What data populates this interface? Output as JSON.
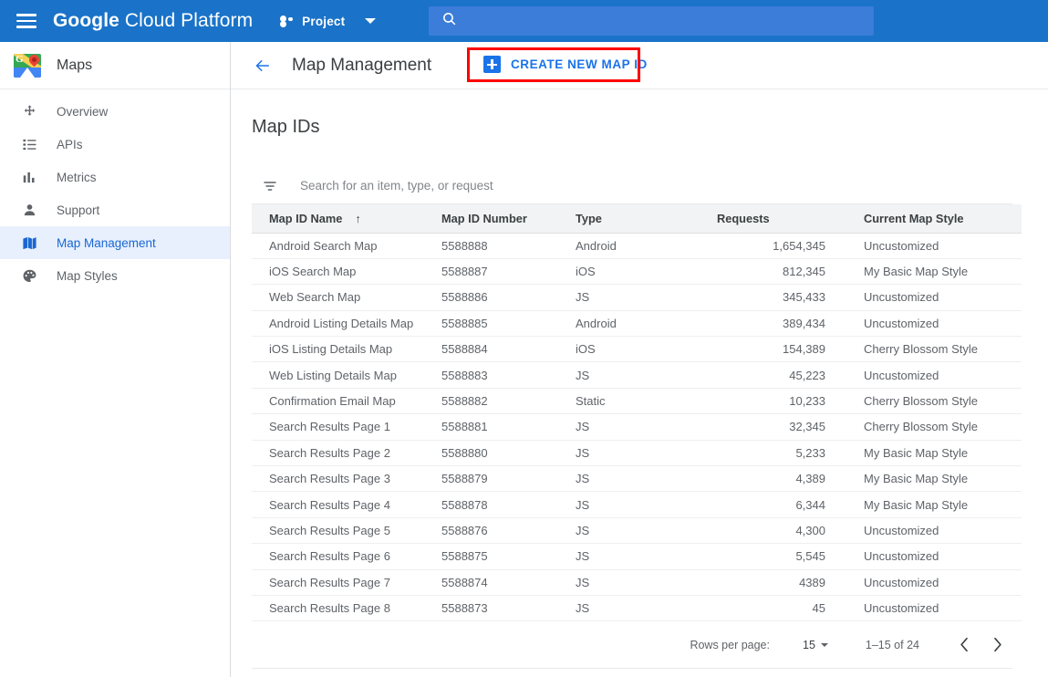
{
  "topbar": {
    "menu_icon": "hamburger-icon",
    "brand_bold": "Google",
    "brand_light": "Cloud Platform",
    "project_label": "Project",
    "project_icon": "project-dots-icon",
    "caret_icon": "chevron-down-icon",
    "search_icon": "search-icon",
    "search_value": "",
    "search_placeholder": "",
    "background_color": "#1a73c8",
    "search_background_color": "#3b7dd8"
  },
  "sidebar": {
    "product_title": "Maps",
    "product_icon": "google-maps-logo-icon",
    "items": [
      {
        "label": "Overview",
        "icon": "move-arrows-icon",
        "active": false
      },
      {
        "label": "APIs",
        "icon": "list-icon",
        "active": false
      },
      {
        "label": "Metrics",
        "icon": "bar-chart-icon",
        "active": false
      },
      {
        "label": "Support",
        "icon": "person-icon",
        "active": false
      },
      {
        "label": "Map Management",
        "icon": "map-icon",
        "active": true
      },
      {
        "label": "Map Styles",
        "icon": "palette-icon",
        "active": false
      }
    ],
    "active_color": "#1967d2",
    "active_background": "#e8f0fe"
  },
  "page_header": {
    "back_icon": "back-arrow-icon",
    "title": "Map Management",
    "create_button_label": "CREATE NEW MAP ID",
    "create_button_icon": "plus-square-icon",
    "create_button_color": "#1a73e8",
    "annotation_color": "#ff0000"
  },
  "panel": {
    "title": "Map IDs",
    "filter_icon": "filter-icon",
    "search_value": "",
    "search_placeholder": "Search for an item, type, or request"
  },
  "table": {
    "columns": [
      {
        "label": "Map ID Name",
        "sorted": true,
        "sort_icon": "arrow-up-icon"
      },
      {
        "label": "Map ID Number",
        "sorted": false
      },
      {
        "label": "Type",
        "sorted": false
      },
      {
        "label": "Requests",
        "sorted": false
      },
      {
        "label": "Current Map Style",
        "sorted": false
      }
    ],
    "rows": [
      {
        "name": "Android Search Map",
        "number": "5588888",
        "type": "Android",
        "requests": "1,654,345",
        "style": "Uncustomized"
      },
      {
        "name": "iOS Search Map",
        "number": "5588887",
        "type": "iOS",
        "requests": "812,345",
        "style": "My Basic Map Style"
      },
      {
        "name": "Web Search Map",
        "number": "5588886",
        "type": "JS",
        "requests": "345,433",
        "style": "Uncustomized"
      },
      {
        "name": "Android Listing Details Map",
        "number": "5588885",
        "type": "Android",
        "requests": "389,434",
        "style": "Uncustomized"
      },
      {
        "name": "iOS Listing Details Map",
        "number": "5588884",
        "type": "iOS",
        "requests": "154,389",
        "style": "Cherry Blossom Style"
      },
      {
        "name": "Web Listing Details Map",
        "number": "5588883",
        "type": "JS",
        "requests": "45,223",
        "style": "Uncustomized"
      },
      {
        "name": "Confirmation Email Map",
        "number": "5588882",
        "type": "Static",
        "requests": "10,233",
        "style": "Cherry Blossom Style"
      },
      {
        "name": "Search Results Page 1",
        "number": "5588881",
        "type": "JS",
        "requests": "32,345",
        "style": "Cherry Blossom Style"
      },
      {
        "name": "Search Results Page 2",
        "number": "5588880",
        "type": "JS",
        "requests": "5,233",
        "style": "My Basic Map Style"
      },
      {
        "name": "Search Results Page 3",
        "number": "5588879",
        "type": "JS",
        "requests": "4,389",
        "style": "My Basic Map Style"
      },
      {
        "name": "Search Results Page 4",
        "number": "5588878",
        "type": "JS",
        "requests": "6,344",
        "style": "My Basic Map Style"
      },
      {
        "name": "Search Results Page 5",
        "number": "5588876",
        "type": "JS",
        "requests": "4,300",
        "style": "Uncustomized"
      },
      {
        "name": "Search Results Page 6",
        "number": "5588875",
        "type": "JS",
        "requests": "5,545",
        "style": "Uncustomized"
      },
      {
        "name": "Search Results Page 7",
        "number": "5588874",
        "type": "JS",
        "requests": "4389",
        "style": "Uncustomized"
      },
      {
        "name": "Search Results Page 8",
        "number": "5588873",
        "type": "JS",
        "requests": "45",
        "style": "Uncustomized"
      }
    ]
  },
  "pagination": {
    "rows_per_page_label": "Rows per page:",
    "rows_per_page_value": "15",
    "range_label": "1–15 of 24",
    "prev_icon": "chevron-left-icon",
    "next_icon": "chevron-right-icon"
  }
}
